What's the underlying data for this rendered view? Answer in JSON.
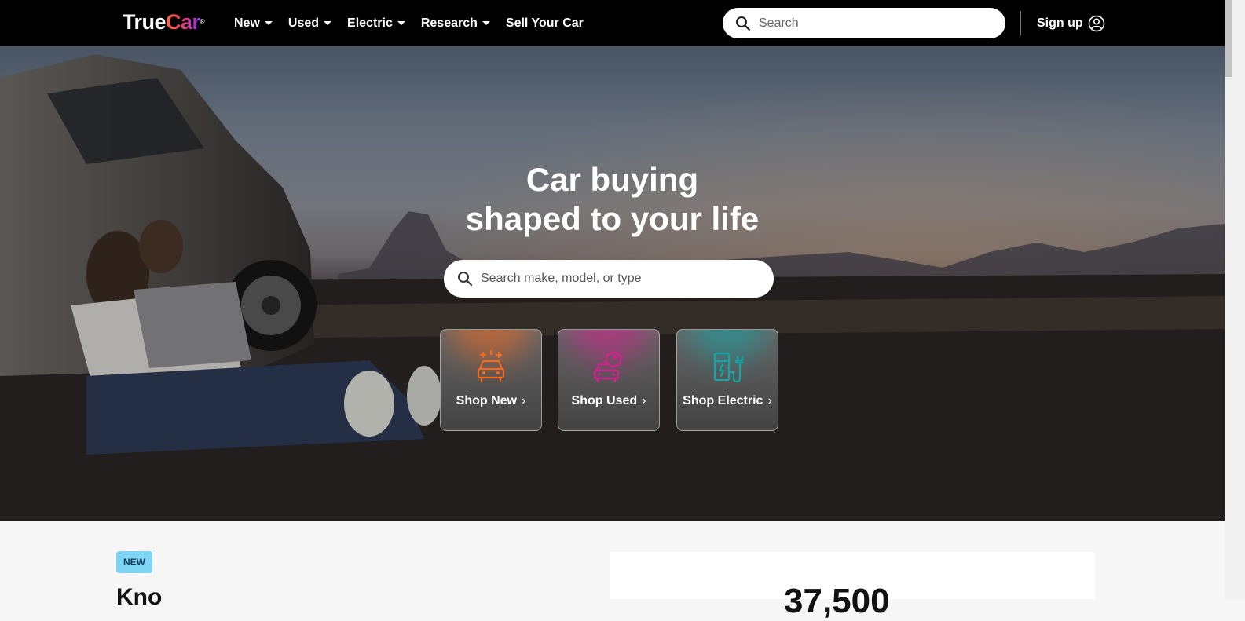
{
  "brand": {
    "logo_part1": "True",
    "logo_part2": "Car",
    "logo_mark": "®"
  },
  "nav": {
    "items": [
      {
        "label": "New",
        "has_dropdown": true
      },
      {
        "label": "Used",
        "has_dropdown": true
      },
      {
        "label": "Electric",
        "has_dropdown": true
      },
      {
        "label": "Research",
        "has_dropdown": true
      },
      {
        "label": "Sell Your Car",
        "has_dropdown": false
      }
    ],
    "search_placeholder": "Search",
    "signup_label": "Sign up",
    "icons": {
      "search": "search-icon",
      "account": "user-circle-icon",
      "dropdown": "caret-down-icon"
    }
  },
  "hero": {
    "title_line1": "Car buying",
    "title_line2": "shaped to your life",
    "search_placeholder": "Search make, model, or type",
    "cards": [
      {
        "label": "Shop New",
        "icon": "sparkle-car-icon",
        "color": "#f26a21"
      },
      {
        "label": "Shop Used",
        "icon": "car-tag-icon",
        "color": "#d6208f"
      },
      {
        "label": "Shop Electric",
        "icon": "ev-charger-icon",
        "color": "#16a6a8"
      }
    ]
  },
  "lower": {
    "badge": "NEW",
    "heading": "Kno",
    "big_number": "37,500"
  },
  "colors": {
    "topbar": "#000000",
    "badge_bg": "#7ed4f4",
    "page_bg": "#f6f6f6"
  }
}
